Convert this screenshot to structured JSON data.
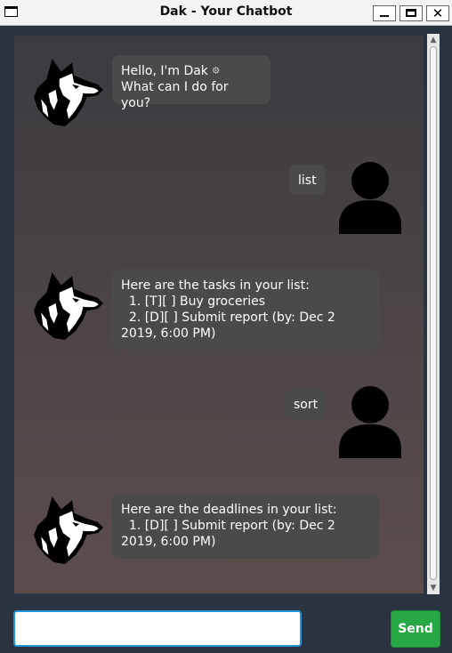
{
  "window": {
    "title": "Dak - Your Chatbot",
    "controls": [
      "minimize",
      "maximize",
      "close"
    ],
    "close_glyph": "✕"
  },
  "messages": [
    {
      "sender": "bot",
      "avatar": "wolf-avatar-icon",
      "text": "Hello, I'm Dak 𖡼\nWhat can I do for you?"
    },
    {
      "sender": "user",
      "avatar": "user-avatar-icon",
      "text": "list"
    },
    {
      "sender": "bot",
      "avatar": "wolf-avatar-icon",
      "text": "Here are the tasks in your list:\n  1. [T][ ] Buy groceries\n  2. [D][ ] Submit report (by: Dec 2\n2019, 6:00 PM)"
    },
    {
      "sender": "user",
      "avatar": "user-avatar-icon",
      "text": "sort"
    },
    {
      "sender": "bot",
      "avatar": "wolf-avatar-icon",
      "text": "Here are the deadlines in your list:\n  1. [D][ ] Submit report (by: Dec 2\n2019, 6:00 PM)"
    }
  ],
  "input": {
    "value": "",
    "placeholder": ""
  },
  "send_button": {
    "label": "Send"
  },
  "colors": {
    "send": "#28a745",
    "bubble": "#4a4a4a",
    "input_focus": "#2196d6",
    "chat_bg_top": "#3c3b40",
    "chat_bg_bottom": "#5c4d4c"
  }
}
